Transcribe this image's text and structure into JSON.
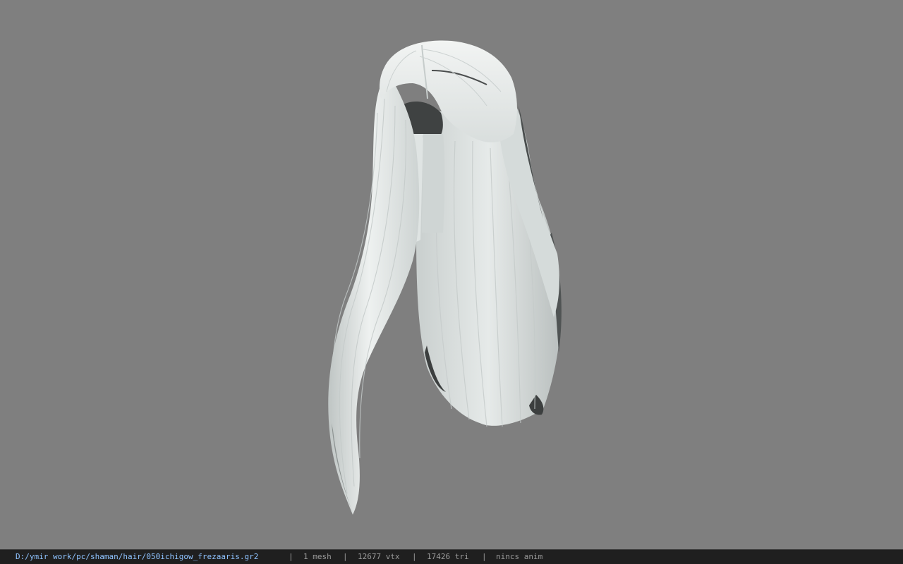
{
  "viewer": {
    "background_color": "#7f7f7f",
    "model_color": "#e4e8e7",
    "model": {
      "name": "hair-model",
      "icon": "hair-mesh"
    }
  },
  "statusbar": {
    "path": "D:/ymir work/pc/shaman/hair/050ichigow_frezaaris.gr2",
    "separator": "|",
    "mesh_count": "1 mesh",
    "vertex_count": "12677 vtx",
    "triangle_count": "17426 tri",
    "anim": "nincs anim",
    "path_color": "#8fc3ff",
    "text_color": "#9a9a9a"
  }
}
